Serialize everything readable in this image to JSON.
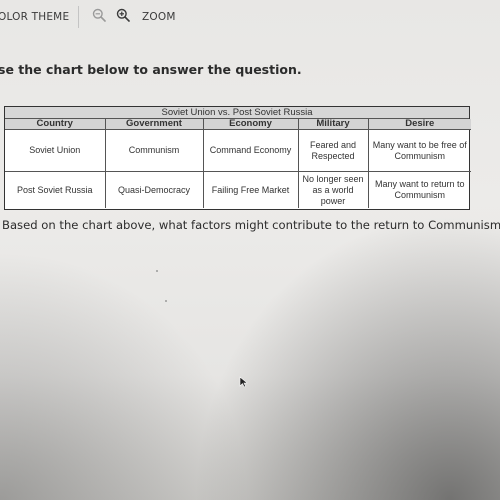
{
  "toolbar": {
    "color_theme_label": "OLOR THEME",
    "zoom_out_icon": "zoom-out-magnifier",
    "zoom_in_icon": "zoom-in-magnifier",
    "zoom_label": "ZOOM"
  },
  "prompt": "se the chart below to answer the question.",
  "table": {
    "title": "Soviet Union vs. Post Soviet Russia",
    "headers": [
      "Country",
      "Government",
      "Economy",
      "Military",
      "Desire"
    ],
    "rows": [
      {
        "country": "Soviet Union",
        "government": "Communism",
        "economy": "Command Economy",
        "military": "Feared and Respected",
        "desire": "Many want to be free of Communism"
      },
      {
        "country": "Post Soviet Russia",
        "government": "Quasi-Democracy",
        "economy": "Failing Free Market",
        "military": "No longer seen as a world power",
        "desire": "Many want to return to Communism"
      }
    ]
  },
  "question": "Based on the chart above, what factors might contribute to the return to Communism?",
  "answer": {
    "value": ""
  },
  "cursor_icon": "mouse-pointer-arrow"
}
